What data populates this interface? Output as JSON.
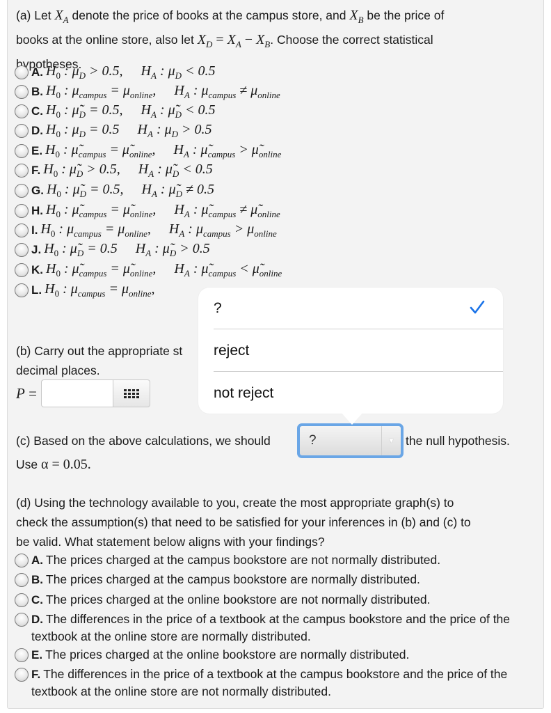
{
  "part_a": {
    "intro_1": "(a) Let",
    "var_XA": "X",
    "var_XA_sub": "A",
    "intro_2": "denote the price of books at the campus store, and",
    "var_XB": "X",
    "var_XB_sub": "B",
    "intro_3": "be the price of",
    "intro_4": "books at the online store, also let",
    "equation": "X_D = X_A − X_B",
    "intro_5": ". Choose the correct statistical",
    "intro_6": "hypotheses.",
    "options": [
      {
        "letter": "A.",
        "h0": "H₀ : μ_D > 0.5,",
        "ha": "H_A : μ_D < 0.5"
      },
      {
        "letter": "B.",
        "h0": "H₀ : μ_campus = μ_online,",
        "ha": "H_A : μ_campus ≠ μ_online"
      },
      {
        "letter": "C.",
        "h0": "H₀ : μ̃_D = 0.5,",
        "ha": "H_A : μ̃_D < 0.5"
      },
      {
        "letter": "D.",
        "h0": "H₀ : μ_D = 0.5",
        "ha": "H_A : μ_D > 0.5"
      },
      {
        "letter": "E.",
        "h0": "H₀ : μ̃_campus = μ̃_online,",
        "ha": "H_A : μ̃_campus > μ̃_online"
      },
      {
        "letter": "F.",
        "h0": "H₀ : μ̃_D > 0.5,",
        "ha": "H_A : μ̃_D < 0.5"
      },
      {
        "letter": "G.",
        "h0": "H₀ : μ̃_D = 0.5,",
        "ha": "H_A : μ̃_D ≠ 0.5"
      },
      {
        "letter": "H.",
        "h0": "H₀ : μ̃_campus = μ̃_online,",
        "ha": "H_A : μ̃_campus ≠ μ̃_online"
      },
      {
        "letter": "I.",
        "h0": "H₀ : μ_campus = μ_online,",
        "ha": "H_A : μ_campus > μ_online"
      },
      {
        "letter": "J.",
        "h0": "H₀ : μ̃_D = 0.5",
        "ha": "H_A : μ̃_D > 0.5"
      },
      {
        "letter": "K.",
        "h0": "H₀ : μ̃_campus = μ̃_online,",
        "ha": "H_A : μ̃_campus < μ̃_online"
      },
      {
        "letter": "L.",
        "h0": "H₀ : μ_campus = μ_online,",
        "ha": ""
      }
    ]
  },
  "part_b": {
    "text_1": "(b) Carry out the appropriate st",
    "text_2": "decimal places.",
    "p_label": "P =",
    "p_value": "",
    "keypad_icon": "grid-icon"
  },
  "part_c": {
    "text_before": "(c) Based on the above calculations, we should",
    "select_value": "?",
    "text_after": "the null hypothesis.",
    "use_label": "Use",
    "alpha": "α = 0.05."
  },
  "dropdown": {
    "options": [
      "?",
      "reject",
      "not reject"
    ],
    "selected": "?",
    "check_color": "#1a73e8"
  },
  "part_d": {
    "line_1": "(d) Using the technology available to you, create the most appropriate graph(s) to",
    "line_2": "check the assumption(s) that need to be satisfied for your inferences in (b) and (c) to",
    "line_3": "be valid. What statement below aligns with your findings?",
    "options": [
      {
        "letter": "A.",
        "text": "The prices charged at the campus bookstore are not normally distributed."
      },
      {
        "letter": "B.",
        "text": "The prices charged at the campus bookstore are normally distributed."
      },
      {
        "letter": "C.",
        "text": "The prices charged at the online bookstore are not normally distributed."
      },
      {
        "letter": "D.",
        "text": "The differences in the price of a textbook at the campus bookstore and the price of the textbook at the online store are normally distributed."
      },
      {
        "letter": "E.",
        "text": "The prices charged at the online bookstore are normally distributed."
      },
      {
        "letter": "F.",
        "text": "The differences in the price of a textbook at the campus bookstore and the price of the textbook at the online store are not normally distributed."
      }
    ]
  }
}
